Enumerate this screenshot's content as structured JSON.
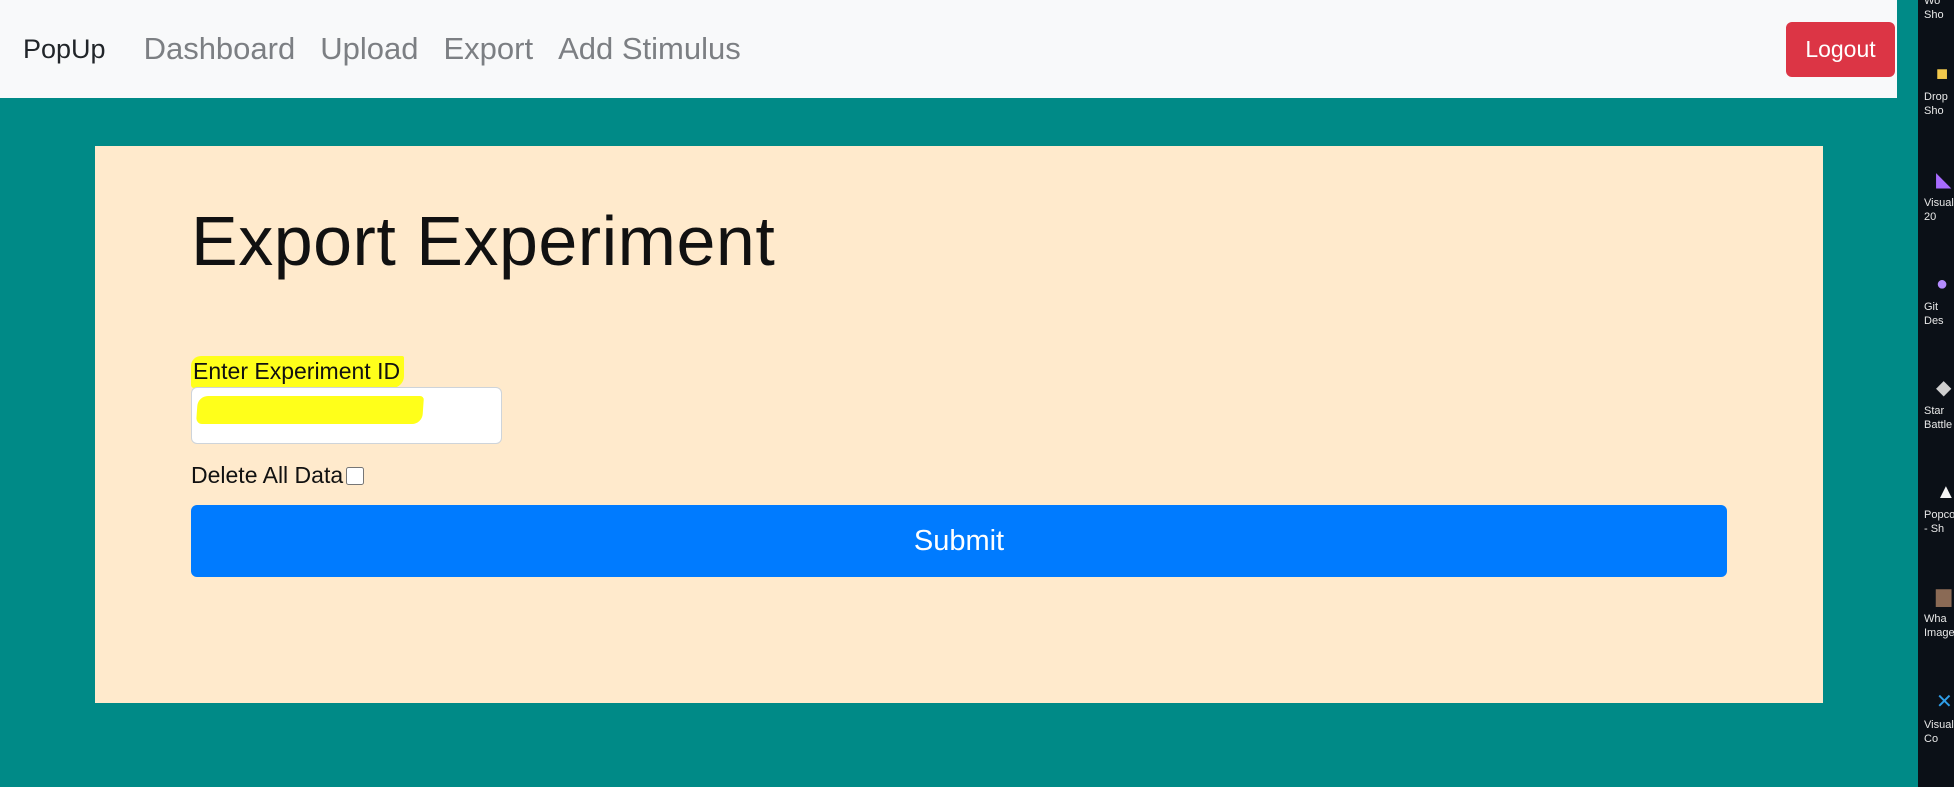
{
  "navbar": {
    "brand": "PopUp",
    "links": [
      "Dashboard",
      "Upload",
      "Export",
      "Add Stimulus"
    ],
    "logout_label": "Logout"
  },
  "form": {
    "title": "Export Experiment",
    "experiment_id_label": "Enter Experiment ID",
    "experiment_id_value": "",
    "delete_all_label": "Delete All Data",
    "delete_all_checked": false,
    "submit_label": "Submit"
  },
  "desktop_icons": [
    {
      "label": "Wo",
      "sub": "Sho",
      "icon": "document-icon"
    },
    {
      "label": "Drop",
      "sub": "Sho",
      "icon": "folder-icon"
    },
    {
      "label": "Visual",
      "sub": "20",
      "icon": "visual-studio-icon"
    },
    {
      "label": "Git",
      "sub": "Des",
      "icon": "github-desktop-icon"
    },
    {
      "label": "Star",
      "sub": "Battle",
      "icon": "game-icon"
    },
    {
      "label": "Popco",
      "sub": "- Sh",
      "icon": "popcorn-icon"
    },
    {
      "label": "Wha",
      "sub": "Image",
      "icon": "image-icon"
    },
    {
      "label": "Visual",
      "sub": "Co",
      "icon": "vscode-icon"
    }
  ],
  "colors": {
    "background": "#008a87",
    "card": "#ffeacc",
    "navbar": "#f8f9fa",
    "logout": "#dc3545",
    "submit": "#007bff",
    "highlight": "#ffff1a"
  }
}
